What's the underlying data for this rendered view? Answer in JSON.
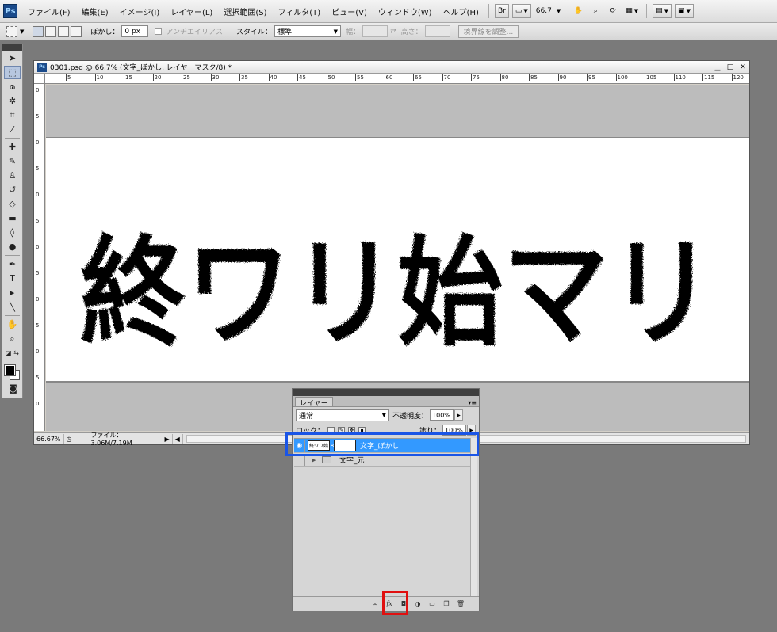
{
  "menubar": {
    "logo": "Ps",
    "items": [
      "ファイル(F)",
      "編集(E)",
      "イメージ(I)",
      "レイヤー(L)",
      "選択範囲(S)",
      "フィルタ(T)",
      "ビュー(V)",
      "ウィンドウ(W)",
      "ヘルプ(H)"
    ],
    "bridge_label": "Br",
    "zoom": "66.7"
  },
  "options": {
    "feather_label": "ぼかし：",
    "feather_value": "0 px",
    "antialias_label": "アンチエイリアス",
    "style_label": "スタイル：",
    "style_value": "標準",
    "width_label": "幅：",
    "height_label": "高さ：",
    "refine_label": "境界線を調整..."
  },
  "document": {
    "title": "0301.psd @ 66.7% (文字_ぼかし, レイヤーマスク/8) *",
    "ruler_h": [
      "5",
      "10",
      "15",
      "20",
      "25",
      "30",
      "35",
      "40",
      "45",
      "50",
      "55",
      "60",
      "65",
      "70",
      "75",
      "80",
      "85",
      "90",
      "95",
      "100",
      "105",
      "110",
      "115",
      "120"
    ],
    "ruler_v": [
      "0",
      "5",
      "0",
      "5",
      "0",
      "5",
      "0",
      "5",
      "0",
      "5",
      "0",
      "5",
      "0"
    ],
    "artwork_text": "終ワリ始マリ",
    "zoom_status": "66.67%",
    "file_status": "ファイル：3.06M/7.19M"
  },
  "layers": {
    "tab": "レイヤー",
    "blend_mode": "通常",
    "opacity_label": "不透明度：",
    "opacity_value": "100%",
    "lock_label": "ロック：",
    "fill_label": "塗り：",
    "fill_value": "100%",
    "rows": [
      {
        "name": "文字_ぼかし",
        "thumb_text": "終ワリ始"
      },
      {
        "name": "文字_元"
      }
    ],
    "bottom_icons": [
      "link-icon",
      "fx-icon",
      "add-mask-icon",
      "adjustment-icon",
      "group-icon",
      "new-layer-icon",
      "trash-icon"
    ],
    "fx_label": "fx"
  },
  "colors": {
    "selected_layer": "#3399ff",
    "highlight_blue": "#1a55e6",
    "highlight_red": "#e01010"
  }
}
